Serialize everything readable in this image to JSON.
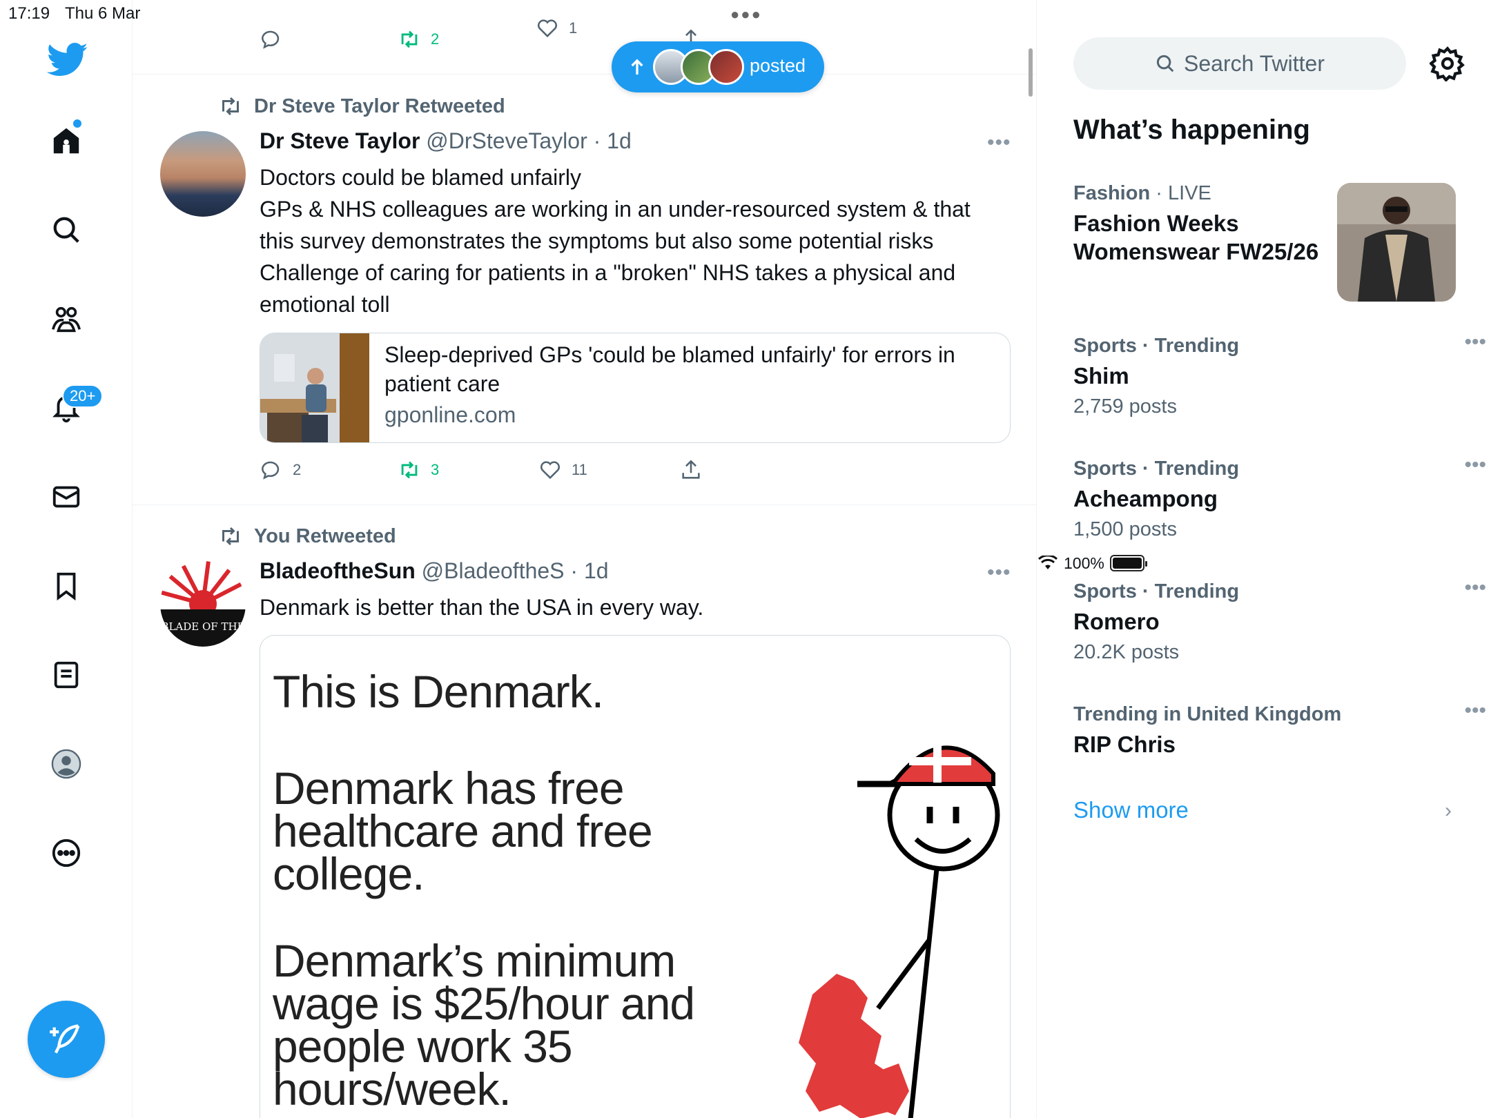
{
  "status_bar": {
    "time": "17:19",
    "date": "Thu 6 Mar",
    "battery": "100%"
  },
  "nav": {
    "notifications_badge": "20+",
    "icons": [
      "twitter-bird-icon",
      "home-icon",
      "search-icon",
      "communities-icon",
      "bell-icon",
      "mail-icon",
      "bookmark-icon",
      "lists-icon",
      "profile-icon",
      "more-icon",
      "compose-icon"
    ]
  },
  "top_actions": {
    "reply": "",
    "retweets": "2",
    "likes": "1"
  },
  "new_posts_pill": {
    "label": "posted"
  },
  "tweets": [
    {
      "retweeted_by": "Dr Steve Taylor Retweeted",
      "name": "Dr Steve Taylor",
      "handle": "@DrSteveTaylor",
      "time": "· 1d",
      "lines": [
        "Doctors could be blamed unfairly",
        "GPs & NHS colleagues are working in an under-resourced system & that this survey demonstrates the symptoms but also some potential risks",
        "Challenge of caring for patients in a \"broken\" NHS takes a physical and emotional toll"
      ],
      "card": {
        "title": "Sleep-deprived GPs 'could be blamed unfairly' for errors in patient care",
        "domain": "gponline.com"
      },
      "replies": "2",
      "retweets": "3",
      "likes": "11"
    },
    {
      "retweeted_by": "You Retweeted",
      "name": "BladeoftheSun",
      "handle": "@BladeoftheS",
      "time": "· 1d",
      "text": "Denmark is better than the USA in every way.",
      "meme": {
        "line1": "This is Denmark.",
        "line2": "Denmark has free healthcare and free college.",
        "line3": "Denmark’s minimum wage is $25/hour and people work 35 hours/week."
      },
      "avatar_text": "BLADE OF THE"
    }
  ],
  "sidebar": {
    "search_placeholder": "Search Twitter",
    "heading": "What’s happening",
    "trends": [
      {
        "category": "Fashion",
        "tag": "· LIVE",
        "title": "Fashion Weeks Womenswear FW25/26",
        "count": ""
      },
      {
        "category": "Sports · Trending",
        "tag": "",
        "title": "Shim",
        "count": "2,759 posts"
      },
      {
        "category": "Sports · Trending",
        "tag": "",
        "title": "Acheampong",
        "count": "1,500 posts"
      },
      {
        "category": "Sports · Trending",
        "tag": "",
        "title": "Romero",
        "count": "20.2K posts"
      },
      {
        "category": "Trending in United Kingdom",
        "tag": "",
        "title": "RIP Chris",
        "count": ""
      }
    ],
    "show_more": "Show more"
  },
  "colors": {
    "accent": "#1d9bf0",
    "retweet": "#00ba7c",
    "muted": "#536471"
  }
}
